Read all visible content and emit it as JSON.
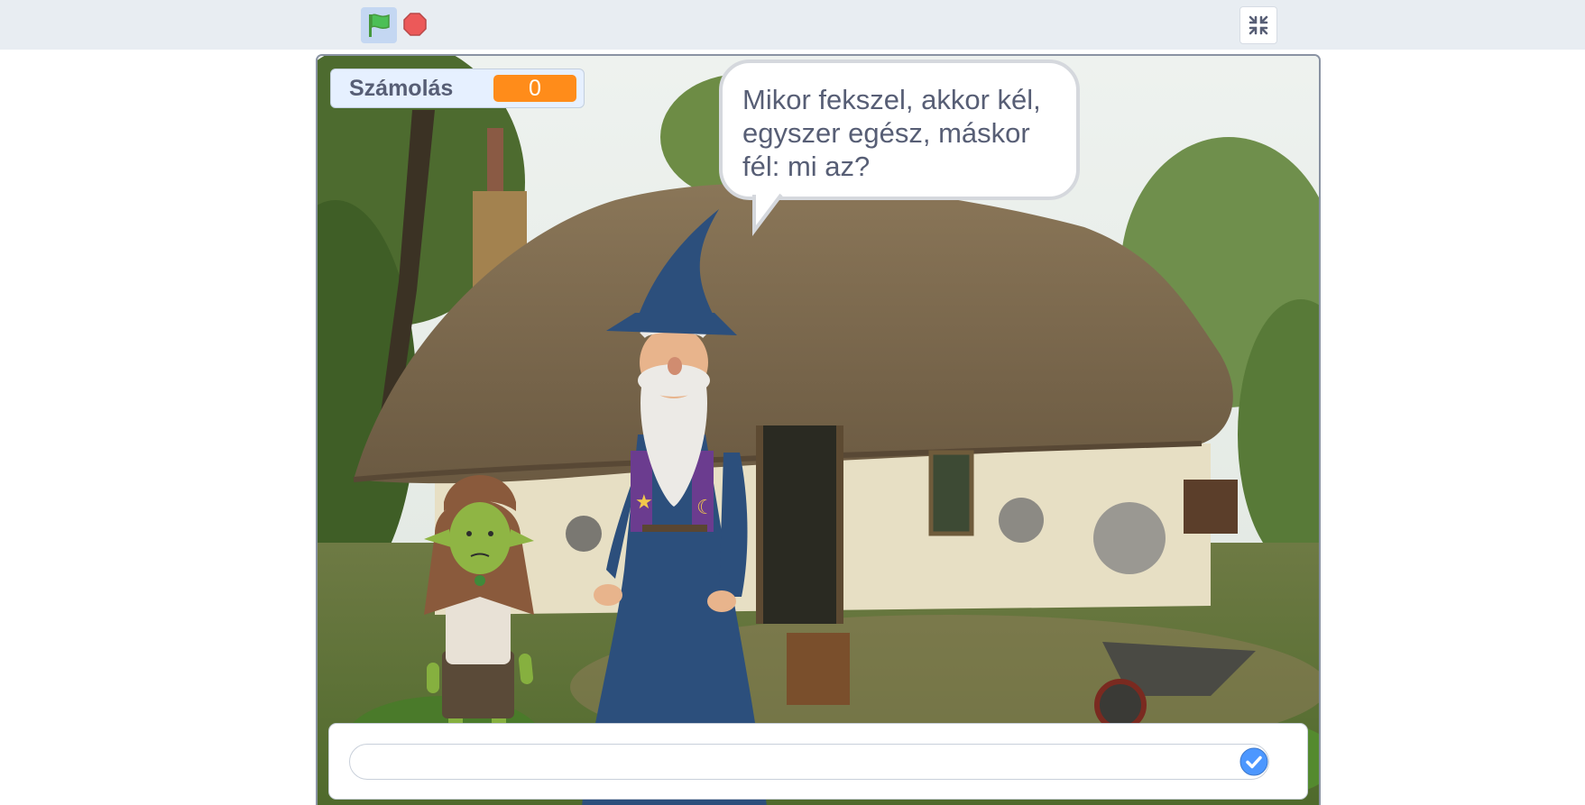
{
  "toolbar": {
    "green_flag_icon": "green-flag-icon",
    "stop_icon": "stop-sign-icon",
    "fullscreen_icon": "exit-fullscreen-icon"
  },
  "monitor": {
    "label": "Számolás",
    "value": "0",
    "value_color": "#ff8c1a"
  },
  "speech_bubble": {
    "lines": [
      "Mikor fekszel, akkor kél,",
      "egyszer egész, máskor",
      "fél: mi az?"
    ]
  },
  "ask_prompt": {
    "value": "",
    "submit_icon": "check-icon",
    "accent_color": "#4c97ff"
  }
}
